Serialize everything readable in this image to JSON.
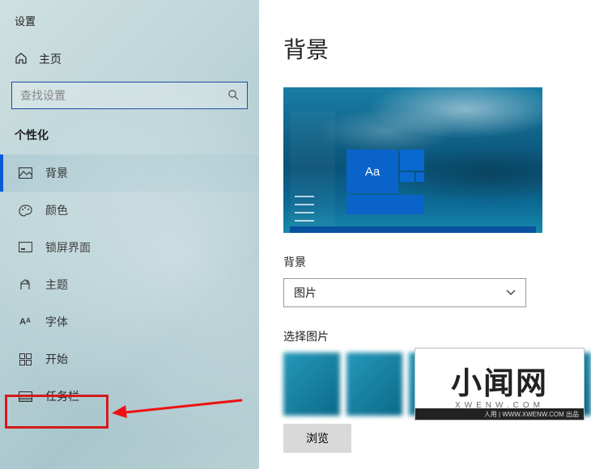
{
  "app_title": "设置",
  "home_label": "主页",
  "search_placeholder": "查找设置",
  "section_title": "个性化",
  "nav_items": [
    {
      "key": "background",
      "label": "背景",
      "icon": "picture-icon",
      "active": true
    },
    {
      "key": "colors",
      "label": "颜色",
      "icon": "palette-icon",
      "active": false
    },
    {
      "key": "lockscreen",
      "label": "锁屏界面",
      "icon": "lockscreen-icon",
      "active": false
    },
    {
      "key": "themes",
      "label": "主题",
      "icon": "theme-icon",
      "active": false
    },
    {
      "key": "fonts",
      "label": "字体",
      "icon": "font-icon",
      "active": false
    },
    {
      "key": "start",
      "label": "开始",
      "icon": "start-icon",
      "active": false
    },
    {
      "key": "taskbar",
      "label": "任务栏",
      "icon": "taskbar-icon",
      "active": false
    }
  ],
  "page_heading": "背景",
  "preview_sample_text": "Aa",
  "bg_label": "背景",
  "bg_dropdown_value": "图片",
  "choose_label": "选择图片",
  "browse_label": "浏览",
  "watermark": {
    "big": "小闻网",
    "small": "XWENW.COM",
    "footer": "人用 | WWW.XWENW.COM 出品"
  }
}
